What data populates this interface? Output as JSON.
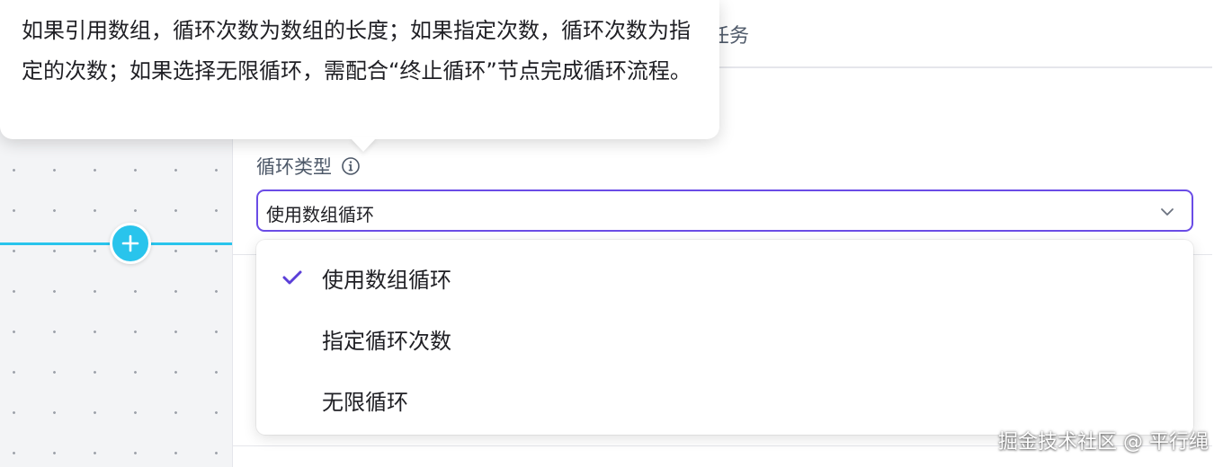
{
  "tooltip": {
    "text": "如果引用数组，循环次数为数组的长度；如果指定次数，循环次数为指定的次数；如果选择无限循环，需配合“终止循环”节点完成循环流程。"
  },
  "header": {
    "tab_label": "任务"
  },
  "loop_type": {
    "label": "循环类型",
    "info_icon": "info-icon",
    "selected_value": "使用数组循环",
    "options": [
      {
        "label": "使用数组循环",
        "selected": true
      },
      {
        "label": "指定循环次数",
        "selected": false
      },
      {
        "label": "无限循环",
        "selected": false
      }
    ]
  },
  "canvas": {
    "add_button_icon": "plus-icon"
  },
  "watermark": {
    "text": "掘金技术社区 @ 平行绳"
  },
  "colors": {
    "accent": "#6a4ce6",
    "connector": "#29c4ec",
    "check": "#5b3fd8"
  }
}
